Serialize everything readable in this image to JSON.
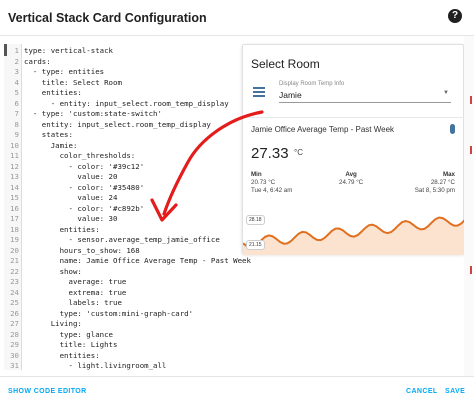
{
  "dialog": {
    "title": "Vertical Stack Card Configuration",
    "help_glyph": "?"
  },
  "editor": {
    "lines": [
      "type: vertical-stack",
      "cards:",
      "  - type: entities",
      "    title: Select Room",
      "    entities:",
      "      - entity: input_select.room_temp_display",
      "  - type: 'custom:state-switch'",
      "    entity: input_select.room_temp_display",
      "    states:",
      "      Jamie:",
      "        color_thresholds:",
      "          - color: '#39c12'",
      "            value: 20",
      "          - color: '#35480'",
      "            value: 24",
      "          - color: '#c892b'",
      "            value: 30",
      "        entities:",
      "          - sensor.average_temp_jamie_office",
      "        hours_to_show: 168",
      "        name: Jamie Office Average Temp - Past Week",
      "        show:",
      "          average: true",
      "          extrema: true",
      "          labels: true",
      "        type: 'custom:mini-graph-card'",
      "      Living:",
      "        type: glance",
      "        title: Lights",
      "        entities:",
      "          - light.livingroom_all"
    ]
  },
  "preview": {
    "title": "Select Room",
    "select_label": "Display Room Temp Info",
    "select_value": "Jamie",
    "caret": "▼",
    "graph_name": "Jamie Office Average Temp - Past Week",
    "state": "27.33",
    "unit": "°C",
    "min_label": "Min",
    "min_value": "20.73 °C",
    "min_time": "Tue 4, 6:42 am",
    "avg_label": "Avg",
    "avg_value": "24.79 °C",
    "max_label": "Max",
    "max_value": "28.27 °C",
    "max_time": "Sat 8, 5:30 pm",
    "label_top": "28.18",
    "label_bottom": "21.15",
    "line_color": "#e07020",
    "accent_color": "#03a9f4",
    "icon_color": "#44739e"
  },
  "footer": {
    "show_code": "SHOW CODE EDITOR",
    "cancel": "CANCEL",
    "save": "SAVE"
  }
}
